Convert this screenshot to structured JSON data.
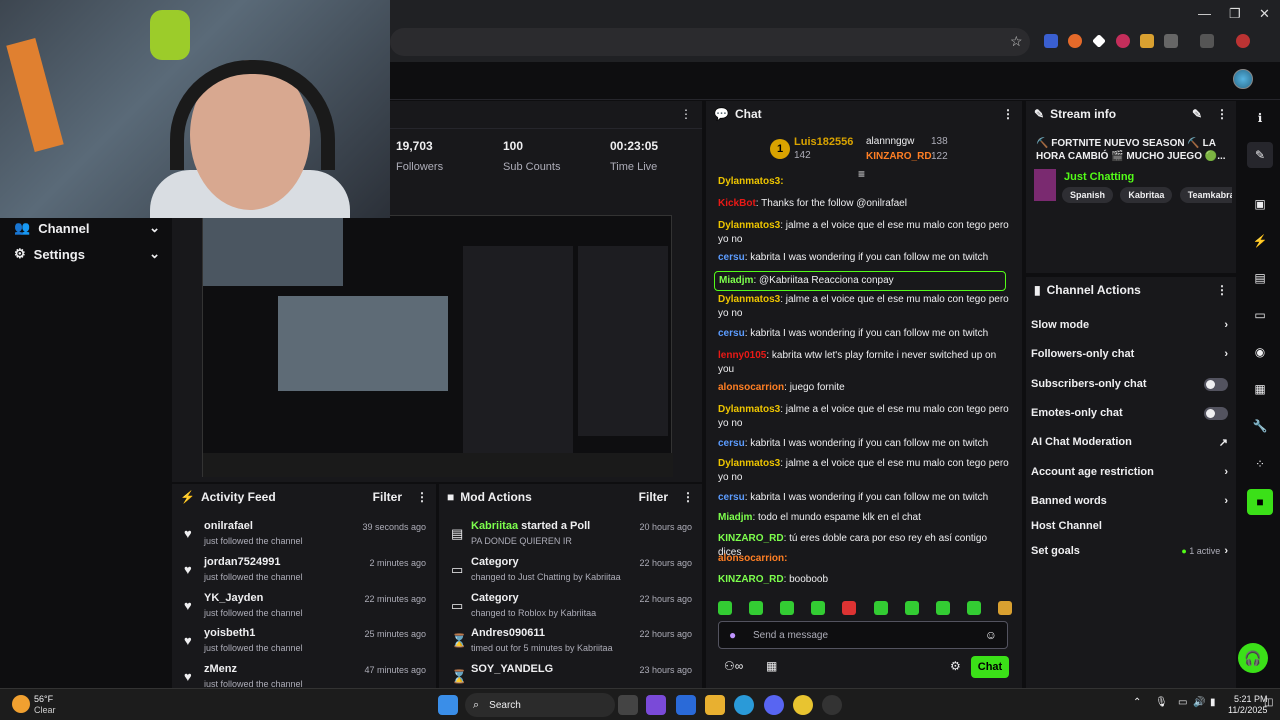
{
  "stats": {
    "followers_value": "19,703",
    "followers_label": "Followers",
    "subs_value": "100",
    "subs_label": "Sub Counts",
    "time_value": "00:23:05",
    "time_label": "Time Live"
  },
  "leftnav": [
    {
      "label": "Channel"
    },
    {
      "label": "Settings"
    }
  ],
  "activity": {
    "title": "Activity Feed",
    "filter": "Filter",
    "items": [
      {
        "name": "onilrafael",
        "sub": "just followed the channel",
        "time": "39 seconds ago"
      },
      {
        "name": "jordan7524991",
        "sub": "just followed the channel",
        "time": "2 minutes ago"
      },
      {
        "name": "YK_Jayden",
        "sub": "just followed the channel",
        "time": "22 minutes ago"
      },
      {
        "name": "yoisbeth1",
        "sub": "just followed the channel",
        "time": "25 minutes ago"
      },
      {
        "name": "zMenz",
        "sub": "just followed the channel",
        "time": "47 minutes ago"
      }
    ]
  },
  "mod": {
    "title": "Mod Actions",
    "filter": "Filter",
    "items": [
      {
        "name": "Kabriitaa",
        "name_suffix": " started a Poll",
        "sub": "PA DONDE QUIEREN IR",
        "time": "20 hours ago"
      },
      {
        "name": "Category",
        "sub": "changed to Just Chatting by Kabriitaa",
        "time": "22 hours ago"
      },
      {
        "name": "Category",
        "sub": "changed to Roblox by Kabriitaa",
        "time": "22 hours ago"
      },
      {
        "name": "Andres090611",
        "sub": "timed out for 5 minutes by Kabriitaa",
        "time": "22 hours ago"
      },
      {
        "name": "SOY_YANDELG",
        "sub": "",
        "time": "23 hours ago"
      }
    ]
  },
  "chat": {
    "title": "Chat",
    "top1_name": "Luis182556",
    "top1_count": "142",
    "top2_name": "alannnggw",
    "top2_count": "138",
    "top3_name": "KINZARO_RD",
    "top3_count": "122",
    "messages": [
      {
        "user": "Dylanmatos3:",
        "text": "",
        "color": "#eec500"
      },
      {
        "user": "KickBot",
        "text": ": Thanks for the follow @onilrafael",
        "color": "#e91916"
      },
      {
        "user": "Dylanmatos3",
        "text": ": jalme a el voice que el ese mu malo con tego pero yo no",
        "color": "#eec500"
      },
      {
        "user": "cersu",
        "text": ": kabrita I was wondering if you can follow me on twitch",
        "color": "#5c9cff"
      },
      {
        "user": "Miadjm",
        "text": ": @Kabriitaa Reacciona conpay",
        "color": "#7dff4d"
      },
      {
        "user": "Dylanmatos3",
        "text": ": jalme a el voice que el ese mu malo con tego pero yo no",
        "color": "#eec500"
      },
      {
        "user": "cersu",
        "text": ": kabrita I was wondering if you can follow me on twitch",
        "color": "#5c9cff"
      },
      {
        "user": "lenny0105",
        "text": ": kabrita wtw let's play fornite i never switched up on you",
        "color": "#e91916"
      },
      {
        "user": "alonsocarrion",
        "text": ": juego fornite",
        "color": "#ff7f24"
      },
      {
        "user": "Dylanmatos3",
        "text": ": jalme a el voice que el ese mu malo con tego pero yo no",
        "color": "#eec500"
      },
      {
        "user": "cersu",
        "text": ": kabrita I was wondering if you can follow me on twitch",
        "color": "#5c9cff"
      },
      {
        "user": "Dylanmatos3",
        "text": ": jalme a el voice que el ese mu malo con tego pero yo no",
        "color": "#eec500"
      },
      {
        "user": "cersu",
        "text": ": kabrita I was wondering if you can follow me on twitch",
        "color": "#5c9cff"
      },
      {
        "user": "Miadjm",
        "text": ": todo el mundo espame klk en el chat",
        "color": "#7dff4d"
      },
      {
        "user": "KINZARO_RD",
        "text": ": tú eres doble cara por eso rey eh así contigo dices",
        "color": "#7dff4d"
      },
      {
        "user": "alonsocarrion:",
        "text": "",
        "color": "#ff7f24"
      },
      {
        "user": "KINZARO_RD",
        "text": ": booboob",
        "color": "#7dff4d"
      }
    ],
    "placeholder": "Send a message",
    "send_label": "Chat"
  },
  "streaminfo": {
    "title": "Stream info",
    "stream_title": "⛏️ FORTNITE NUEVO SEASON ⛏️ LA HORA CAMBIÓ 🎬 MUCHO JUEGO 🟢...",
    "category": "Just Chatting",
    "tags": [
      "Spanish",
      "Kabritaa",
      "Teamkabra"
    ]
  },
  "chanact": {
    "title": "Channel Actions",
    "items": [
      {
        "label": "Slow mode",
        "ctrl": "chevron"
      },
      {
        "label": "Followers-only chat",
        "ctrl": "chevron"
      },
      {
        "label": "Subscribers-only chat",
        "ctrl": "toggle"
      },
      {
        "label": "Emotes-only chat",
        "ctrl": "toggle"
      },
      {
        "label": "AI Chat Moderation",
        "ctrl": "external"
      },
      {
        "label": "Account age restriction",
        "ctrl": "chevron"
      },
      {
        "label": "Banned words",
        "ctrl": "chevron"
      },
      {
        "label": "Host Channel",
        "ctrl": "none"
      },
      {
        "label": "Set goals",
        "ctrl": "chevron",
        "extra": "1 active"
      }
    ]
  },
  "taskbar": {
    "weather_temp": "56°F",
    "weather_desc": "Clear",
    "search": "Search",
    "time": "5:21 PM",
    "date": "11/2/2025"
  },
  "colors": {
    "accent": "#53fc18",
    "purple": "#bf94ff",
    "panel": "#18181b",
    "bg": "#0e0e10"
  }
}
